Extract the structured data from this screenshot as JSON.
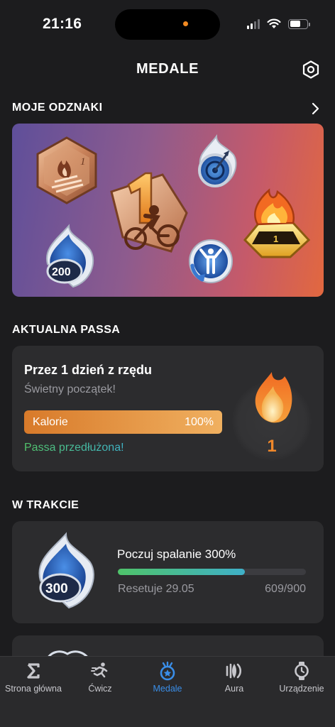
{
  "status_bar": {
    "time": "21:16"
  },
  "header": {
    "title": "MEDALE",
    "settings_icon": "hexagon-settings-icon"
  },
  "badges_section": {
    "title": "MOJE ODZNAKI",
    "chevron_icon": "chevron-right-icon",
    "badges": [
      {
        "name": "bronze-flame-hexagon-badge",
        "label": "1"
      },
      {
        "name": "cycling-number-one-badge",
        "label": "1"
      },
      {
        "name": "blue-target-flame-badge",
        "label": ""
      },
      {
        "name": "gold-flame-podium-badge",
        "label": "1"
      },
      {
        "name": "blue-flame-200-badge",
        "label": "200"
      },
      {
        "name": "blue-exercise-figure-badge",
        "label": ""
      }
    ]
  },
  "streak_section": {
    "title": "AKTUALNA PASSA",
    "card_title": "Przez 1 dzień z rzędu",
    "card_subtitle": "Świetny początek!",
    "bar_label": "Kalorie",
    "bar_value": "100%",
    "bar_progress": 1.0,
    "extended_text": "Passa przedłużona!",
    "streak_count": "1",
    "flame_colors": [
      "#f08a2a",
      "#f4c15a"
    ]
  },
  "in_progress_section": {
    "title": "W TRAKCIE",
    "item_title": "Poczuj spalanie 300%",
    "badge_label": "300",
    "reset_text": "Resetuje 29.05",
    "count_text": "609/900",
    "progress": 0.6767
  },
  "tab_bar": {
    "tabs": [
      {
        "label": "Strona główna",
        "icon": "sigma-icon",
        "active": false
      },
      {
        "label": "Ćwicz",
        "icon": "running-figure-icon",
        "active": false
      },
      {
        "label": "Medale",
        "icon": "medal-icon",
        "active": true
      },
      {
        "label": "Aura",
        "icon": "aura-waves-icon",
        "active": false
      },
      {
        "label": "Urządzenie",
        "icon": "watch-icon",
        "active": false
      }
    ],
    "active_color": "#3a8ee8"
  }
}
